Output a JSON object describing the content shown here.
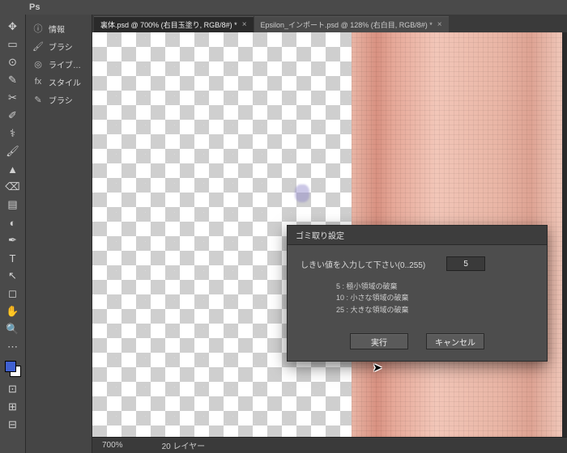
{
  "app": {
    "logo": "Ps"
  },
  "tabs": [
    {
      "label": "裏体.psd @ 700% (右目玉塗り, RGB/8#) *",
      "active": true
    },
    {
      "label": "Epsilon_インポート.psd @ 128% (右白目, RGB/8#) *",
      "active": false
    }
  ],
  "panels": [
    {
      "icon": "ⓘ",
      "label": "情報"
    },
    {
      "icon": "🖌",
      "label": "ブラシ"
    },
    {
      "icon": "◎",
      "label": "ライブ…"
    },
    {
      "icon": "fx",
      "label": "スタイル"
    },
    {
      "icon": "✎",
      "label": "ブラシ"
    }
  ],
  "tools": [
    {
      "glyph": "✥",
      "name": "move-tool"
    },
    {
      "glyph": "▭",
      "name": "marquee-tool"
    },
    {
      "glyph": "⊙",
      "name": "lasso-tool"
    },
    {
      "glyph": "✎",
      "name": "wand-tool"
    },
    {
      "glyph": "✂",
      "name": "crop-tool"
    },
    {
      "glyph": "✐",
      "name": "eyedropper-tool"
    },
    {
      "glyph": "⚕",
      "name": "heal-tool"
    },
    {
      "glyph": "🖌",
      "name": "brush-tool"
    },
    {
      "glyph": "▲",
      "name": "stamp-tool"
    },
    {
      "glyph": "⌫",
      "name": "eraser-tool"
    },
    {
      "glyph": "▤",
      "name": "gradient-tool"
    },
    {
      "glyph": "◐",
      "name": "dodge-tool"
    },
    {
      "glyph": "✒",
      "name": "pen-tool"
    },
    {
      "glyph": "T",
      "name": "type-tool"
    },
    {
      "glyph": "↖",
      "name": "path-tool"
    },
    {
      "glyph": "◻",
      "name": "shape-tool"
    },
    {
      "glyph": "✋",
      "name": "hand-tool"
    },
    {
      "glyph": "🔍",
      "name": "zoom-tool"
    },
    {
      "glyph": "⋯",
      "name": "more-tool"
    }
  ],
  "status": {
    "zoom": "700%",
    "layer": "20 レイヤー"
  },
  "dialog": {
    "title": "ゴミ取り設定",
    "prompt": "しきい値を入力して下さい(0..255)",
    "value": "5",
    "hints": [
      "5 : 極小領域の破棄",
      "10 : 小さな領域の破棄",
      "25 : 大きな領域の破棄"
    ],
    "ok": "実行",
    "cancel": "キャンセル"
  },
  "colors": {
    "fg": "#4060d0",
    "bg": "#ffffff"
  }
}
